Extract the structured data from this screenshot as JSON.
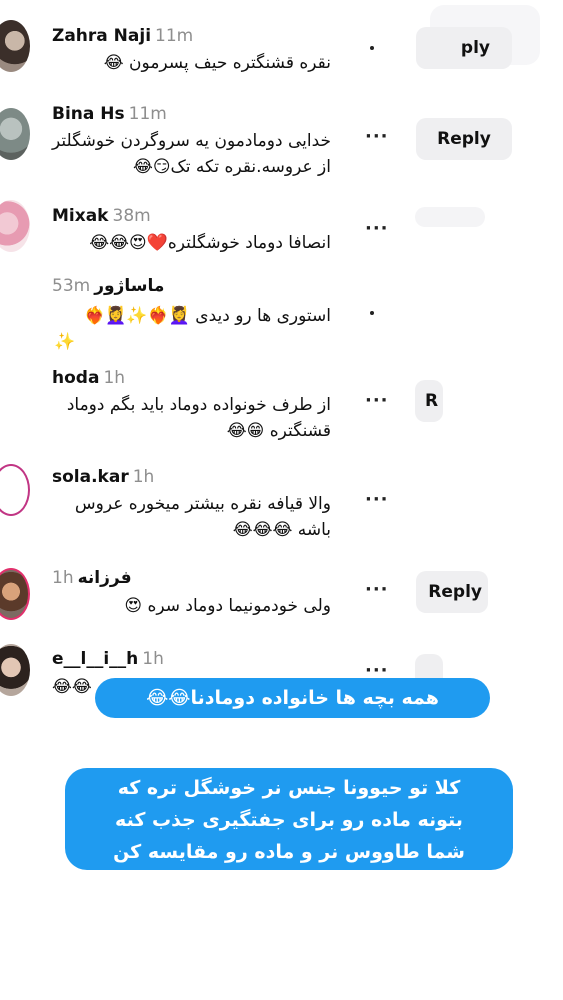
{
  "comments": [
    {
      "user": "Zahra Naji",
      "time": "11m",
      "lines": [
        "نقره قشنگتره حیف پسرمون 😂"
      ],
      "reply": "ply"
    },
    {
      "user": "Bina Hs",
      "time": "11m",
      "lines": [
        "خدایی دومادمون یه سروگردن خوشگلتر",
        "از عروسه.نقره تکه تک😏😂"
      ],
      "reply": "Reply",
      "more": "···"
    },
    {
      "user": "Mixak",
      "time": "38m",
      "lines": [
        "انصافا دوماد خوشگلتره❤️😍😂😂"
      ],
      "more": "···"
    },
    {
      "user": "ماساژور",
      "time": "53m",
      "lines": [
        "استوری ها رو دیدی 💆‍♀️❤️‍🔥✨💆‍♀️❤️‍🔥",
        "✨"
      ]
    },
    {
      "user": "hoda",
      "time": "1h",
      "lines": [
        "از طرف خونواده دوماد باید بگم دوماد",
        "قشنگتره 😁😂"
      ],
      "more": "···",
      "reply": "R"
    },
    {
      "user": "sola.kar",
      "time": "1h",
      "lines": [
        "والا قیافه نقره بیشتر میخوره عروس",
        "باشه 😂😂😂"
      ],
      "more": "···"
    },
    {
      "user": "فرزانه",
      "time": "1h",
      "lines": [
        "ولی خودمونیما دوماد سره 😍"
      ],
      "more": "···",
      "reply": "Reply"
    },
    {
      "user": "e__l__i__h",
      "time": "1h",
      "lines": [
        "😂😂"
      ],
      "more": "···"
    }
  ],
  "overlay": {
    "caption1": "همه بچه ها خانواده دومادنا😂😂",
    "caption2_lines": [
      "کلا تو حیوونا جنس نر خوشگل تره که",
      "بتونه ماده رو برای جفتگیری جذب کنه",
      "شما طاووس نر و ماده رو مقایسه کن"
    ]
  },
  "colors": {
    "accent": "#1f9bf0",
    "reply_bg": "#efeff1",
    "time": "#8e8e8e"
  }
}
